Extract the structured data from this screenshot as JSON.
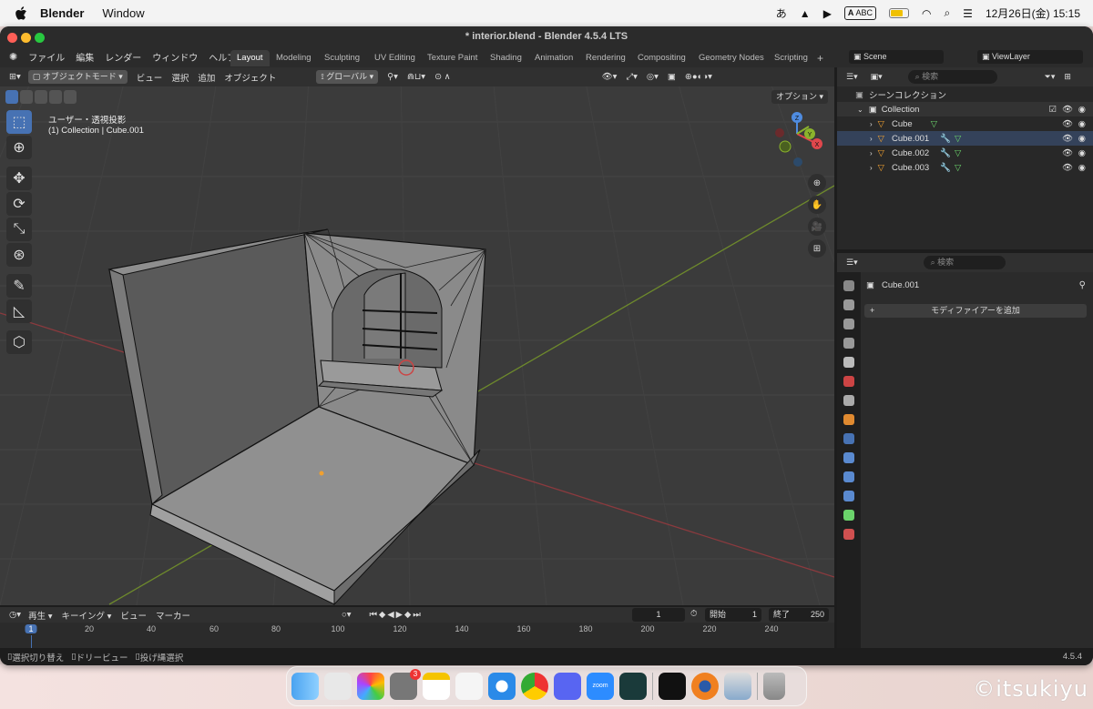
{
  "menubar": {
    "app": "Blender",
    "menu_window": "Window",
    "datetime": "12月26日(金)  15:15",
    "input": "ABC"
  },
  "window": {
    "title": "* interior.blend - Blender 4.5.4 LTS"
  },
  "topbar": {
    "menus": [
      "ファイル",
      "編集",
      "レンダー",
      "ウィンドウ",
      "ヘルプ"
    ],
    "workspaces": [
      "Layout",
      "Modeling",
      "Sculpting",
      "UV Editing",
      "Texture Paint",
      "Shading",
      "Animation",
      "Rendering",
      "Compositing",
      "Geometry Nodes",
      "Scripting"
    ],
    "active_workspace": "Layout",
    "scene": "Scene",
    "view_layer": "ViewLayer"
  },
  "viewport": {
    "mode": "オブジェクトモード",
    "menus": [
      "ビュー",
      "選択",
      "追加",
      "オブジェクト"
    ],
    "orientation": "グローバル",
    "options": "オプション",
    "overlay_line1": "ユーザー・透視投影",
    "overlay_line2": "(1) Collection | Cube.001",
    "gizmo": {
      "x": "X",
      "y": "Y",
      "z": "Z"
    }
  },
  "outliner": {
    "search_placeholder": "検索",
    "root": "シーンコレクション",
    "collection": "Collection",
    "items": [
      "Cube",
      "Cube.001",
      "Cube.002",
      "Cube.003"
    ]
  },
  "properties": {
    "search_placeholder": "検索",
    "object": "Cube.001",
    "add_modifier": "モディファイアーを追加"
  },
  "timeline": {
    "menus": [
      "再生",
      "キーイング",
      "ビュー",
      "マーカー"
    ],
    "current_frame": "1",
    "start_label": "開始",
    "start": "1",
    "end_label": "終了",
    "end": "250",
    "ruler": [
      "1",
      "20",
      "40",
      "60",
      "80",
      "100",
      "120",
      "140",
      "160",
      "180",
      "200",
      "220",
      "240"
    ]
  },
  "status": {
    "hint1": "選択切り替え",
    "hint2": "ドリービュー",
    "hint3": "投げ縄選択",
    "version": "4.5.4"
  },
  "dock": {
    "badge": "3"
  },
  "watermark": "©itsukiyu",
  "colors": {
    "accent": "#4772b3",
    "viewport": "#3b3b3b",
    "x_axis": "#e0474c",
    "y_axis": "#8bb32c",
    "z_axis": "#4f8ce0"
  }
}
